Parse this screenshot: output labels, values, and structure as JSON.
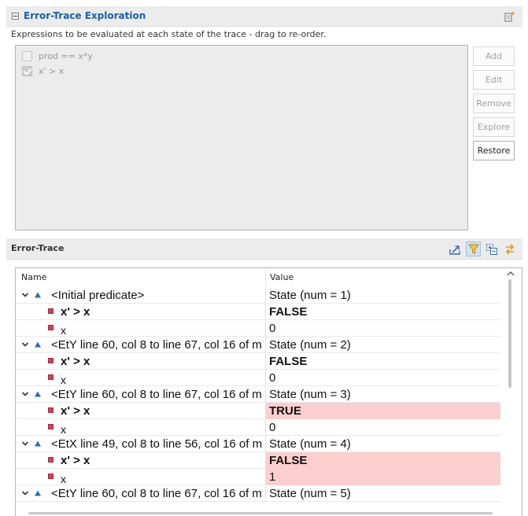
{
  "exploration": {
    "title": "Error-Trace Exploration",
    "subtitle": "Expressions to be evaluated at each state of the trace - drag to re-order.",
    "expressions": [
      {
        "text": "prod == x*y",
        "checked": false
      },
      {
        "text": "x' > x",
        "checked": true
      }
    ],
    "buttons": {
      "add": "Add",
      "edit": "Edit",
      "remove": "Remove",
      "explore": "Explore",
      "restore": "Restore"
    }
  },
  "trace": {
    "title": "Error-Trace",
    "columns": {
      "name": "Name",
      "value": "Value"
    },
    "rows": [
      {
        "kind": "state",
        "name": "<Initial predicate>",
        "value": "State (num = 1)"
      },
      {
        "kind": "var",
        "name": "x' > x",
        "value": "FALSE",
        "bold": true,
        "changed": false
      },
      {
        "kind": "var",
        "name": "x",
        "value": "0",
        "bold": false,
        "changed": false
      },
      {
        "kind": "state",
        "name": "<EtY line 60, col 8 to line 67, col 16 of m",
        "value": "State (num = 2)"
      },
      {
        "kind": "var",
        "name": "x' > x",
        "value": "FALSE",
        "bold": true,
        "changed": false
      },
      {
        "kind": "var",
        "name": "x",
        "value": "0",
        "bold": false,
        "changed": false
      },
      {
        "kind": "state",
        "name": "<EtY line 60, col 8 to line 67, col 16 of m",
        "value": "State (num = 3)"
      },
      {
        "kind": "var",
        "name": "x' > x",
        "value": "TRUE",
        "bold": true,
        "changed": true
      },
      {
        "kind": "var",
        "name": "x",
        "value": "0",
        "bold": false,
        "changed": false
      },
      {
        "kind": "state",
        "name": "<EtX line 49, col 8 to line 56, col 16 of m",
        "value": "State (num = 4)"
      },
      {
        "kind": "var",
        "name": "x' > x",
        "value": "FALSE",
        "bold": true,
        "changed": true
      },
      {
        "kind": "var",
        "name": "x",
        "value": "1",
        "bold": false,
        "changed": true
      },
      {
        "kind": "state",
        "name": "<EtY line 60, col 8 to line 67, col 16 of m",
        "value": "State (num = 5)"
      }
    ]
  },
  "icons": {
    "collapse": "collapse-section-icon",
    "new_window": "open-in-new-window-icon",
    "export": "export-icon",
    "filter": "filter-icon",
    "collapse_all": "collapse-all-icon",
    "sort": "swap-order-icon"
  },
  "colors": {
    "title_blue": "#1b5fa8",
    "changed_bg": "#fccfcf",
    "variable_red": "#d2425a",
    "state_blue": "#2a6fb8"
  }
}
